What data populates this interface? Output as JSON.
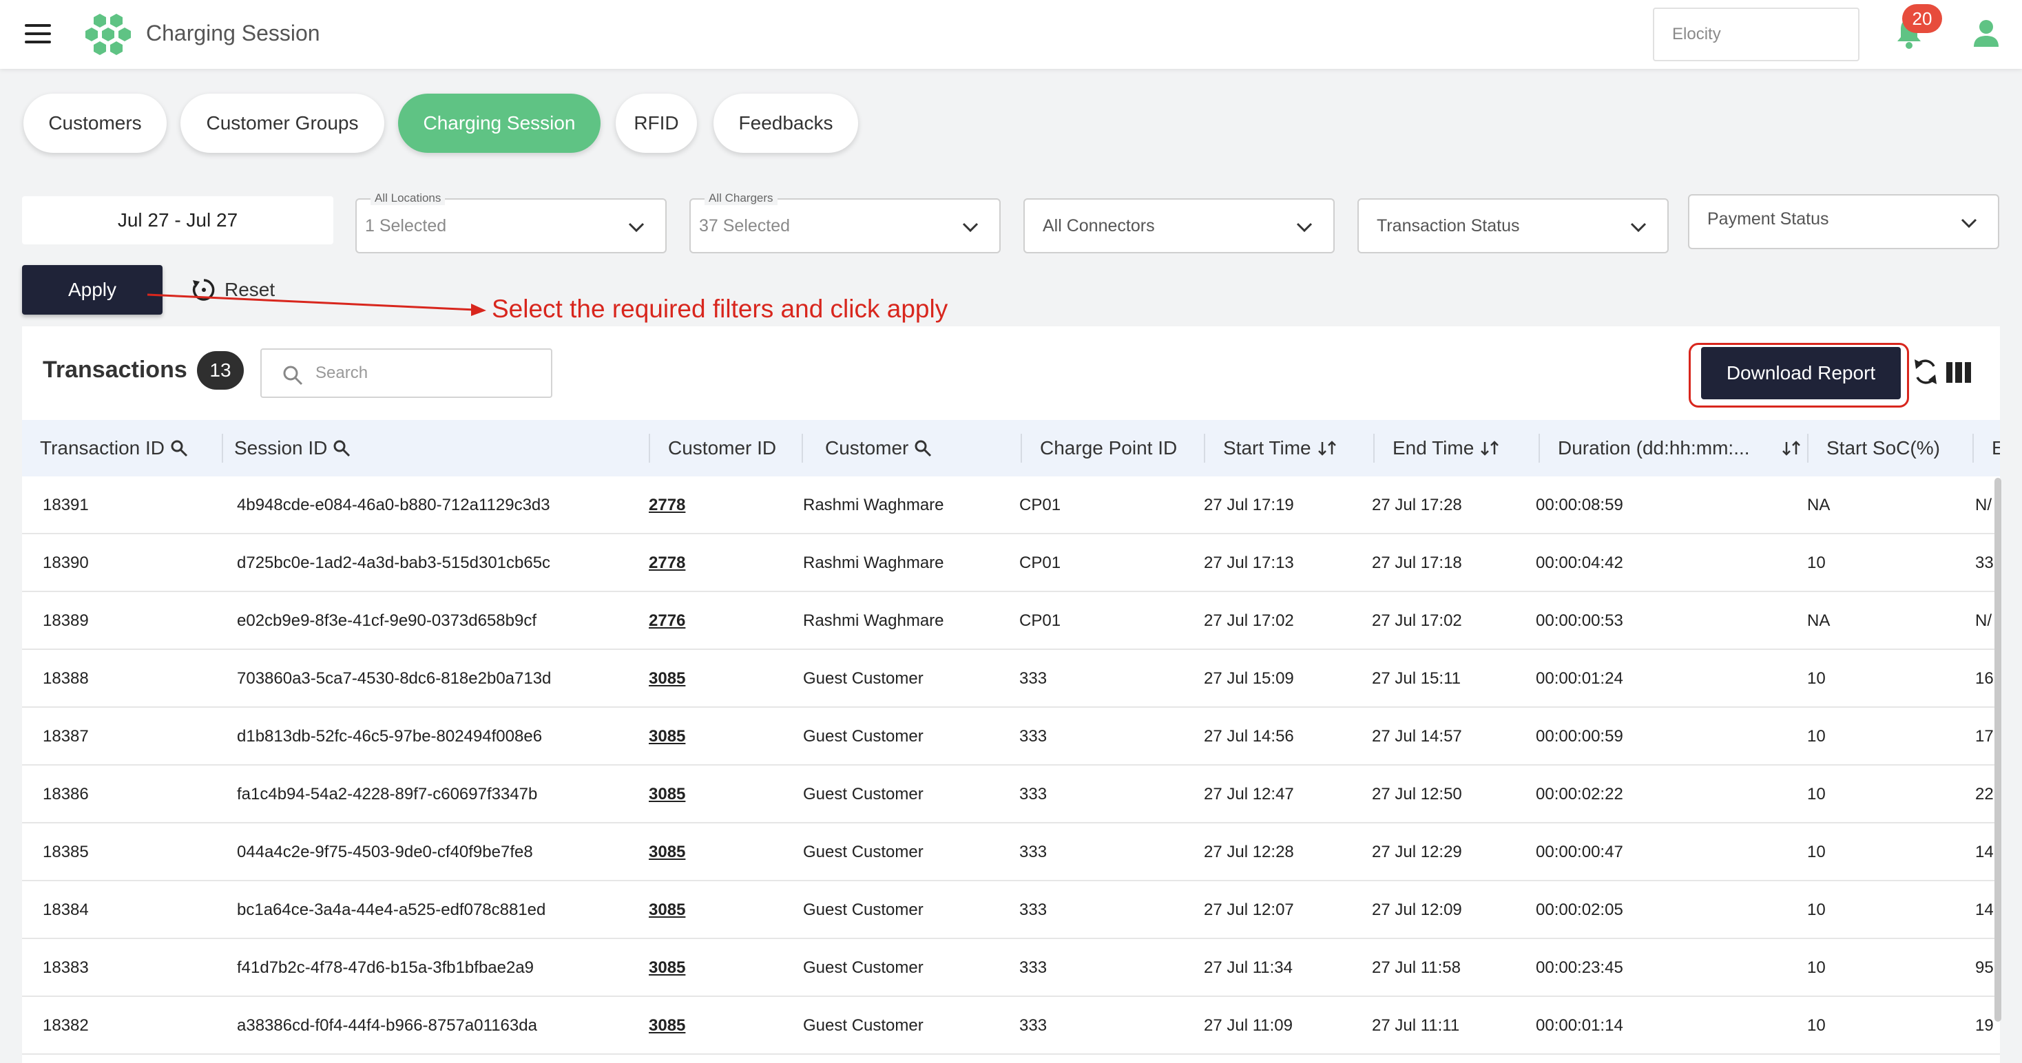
{
  "header": {
    "title": "Charging Session",
    "org_placeholder": "Elocity",
    "notification_count": "20",
    "menu_icon": "hamburger-menu-icon",
    "logo_icon": "hexagon-logo-icon",
    "bell_icon": "bell-icon",
    "user_icon": "user-icon",
    "accent_color": "#5fc384"
  },
  "tabs": [
    {
      "label": "Customers",
      "active": false
    },
    {
      "label": "Customer Groups",
      "active": false
    },
    {
      "label": "Charging Session",
      "active": true
    },
    {
      "label": "RFID",
      "active": false
    },
    {
      "label": "Feedbacks",
      "active": false
    }
  ],
  "filters": {
    "date_range": "Jul 27 - Jul 27",
    "locations": {
      "legend": "All Locations",
      "value": "1 Selected"
    },
    "chargers": {
      "legend": "All Chargers",
      "value": "37 Selected"
    },
    "connectors": {
      "value": "All Connectors"
    },
    "transaction_status": {
      "value": "Transaction Status"
    },
    "payment_status": {
      "value": "Payment Status"
    },
    "apply_label": "Apply",
    "reset_label": "Reset"
  },
  "annotation": {
    "text": "Select the required filters and click apply",
    "color": "#d8261d"
  },
  "table": {
    "title": "Transactions",
    "count": "13",
    "search_placeholder": "Search",
    "download_label": "Download Report",
    "columns": [
      "Transaction ID",
      "Session ID",
      "Customer ID",
      "Customer",
      "Charge Point ID",
      "Start Time",
      "End Time",
      "Duration (dd:hh:mm:...",
      "Start SoC(%)",
      "End"
    ],
    "rows": [
      [
        "18391",
        "4b948cde-e084-46a0-b880-712a1129c3d3",
        "2778",
        "Rashmi Waghmare",
        "CP01",
        "27 Jul 17:19",
        "27 Jul 17:28",
        "00:00:08:59",
        "NA",
        "N/"
      ],
      [
        "18390",
        "d725bc0e-1ad2-4a3d-bab3-515d301cb65c",
        "2778",
        "Rashmi Waghmare",
        "CP01",
        "27 Jul 17:13",
        "27 Jul 17:18",
        "00:00:04:42",
        "10",
        "33"
      ],
      [
        "18389",
        "e02cb9e9-8f3e-41cf-9e90-0373d658b9cf",
        "2776",
        "Rashmi Waghmare",
        "CP01",
        "27 Jul 17:02",
        "27 Jul 17:02",
        "00:00:00:53",
        "NA",
        "N/"
      ],
      [
        "18388",
        "703860a3-5ca7-4530-8dc6-818e2b0a713d",
        "3085",
        "Guest Customer",
        "333",
        "27 Jul 15:09",
        "27 Jul 15:11",
        "00:00:01:24",
        "10",
        "16"
      ],
      [
        "18387",
        "d1b813db-52fc-46c5-97be-802494f008e6",
        "3085",
        "Guest Customer",
        "333",
        "27 Jul 14:56",
        "27 Jul 14:57",
        "00:00:00:59",
        "10",
        "17"
      ],
      [
        "18386",
        "fa1c4b94-54a2-4228-89f7-c60697f3347b",
        "3085",
        "Guest Customer",
        "333",
        "27 Jul 12:47",
        "27 Jul 12:50",
        "00:00:02:22",
        "10",
        "22"
      ],
      [
        "18385",
        "044a4c2e-9f75-4503-9de0-cf40f9be7fe8",
        "3085",
        "Guest Customer",
        "333",
        "27 Jul 12:28",
        "27 Jul 12:29",
        "00:00:00:47",
        "10",
        "14"
      ],
      [
        "18384",
        "bc1a64ce-3a4a-44e4-a525-edf078c881ed",
        "3085",
        "Guest Customer",
        "333",
        "27 Jul 12:07",
        "27 Jul 12:09",
        "00:00:02:05",
        "10",
        "14"
      ],
      [
        "18383",
        "f41d7b2c-4f78-47d6-b15a-3fb1bfbae2a9",
        "3085",
        "Guest Customer",
        "333",
        "27 Jul 11:34",
        "27 Jul 11:58",
        "00:00:23:45",
        "10",
        "95"
      ],
      [
        "18382",
        "a38386cd-f0f4-44f4-b966-8757a01163da",
        "3085",
        "Guest Customer",
        "333",
        "27 Jul 11:09",
        "27 Jul 11:11",
        "00:00:01:14",
        "10",
        "19"
      ]
    ]
  }
}
